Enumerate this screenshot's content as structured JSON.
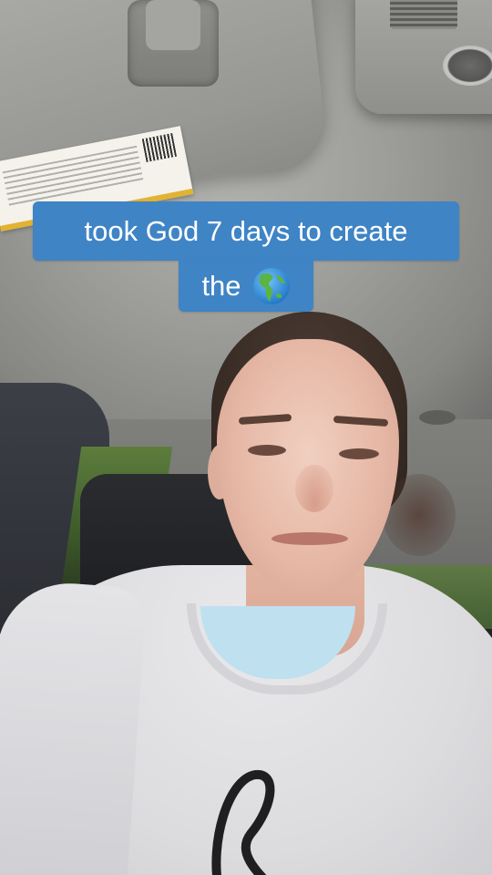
{
  "caption": {
    "line1": "took God 7 days to create",
    "line2_text": "the",
    "line2_icon": "globe-americas-icon"
  },
  "colors": {
    "caption_bg": "#3f84c5",
    "caption_text": "#ffffff"
  },
  "sticker": {
    "text": ""
  }
}
